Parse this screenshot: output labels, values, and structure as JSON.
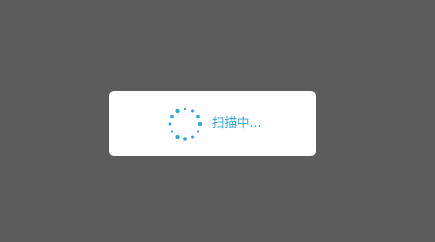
{
  "dialog": {
    "status_text": "扫描中...",
    "spinner_icon": "loading-spinner-icon"
  },
  "colors": {
    "backdrop": "#5c5c5c",
    "dialog_bg": "#ffffff",
    "accent": "#2aa7d6"
  }
}
